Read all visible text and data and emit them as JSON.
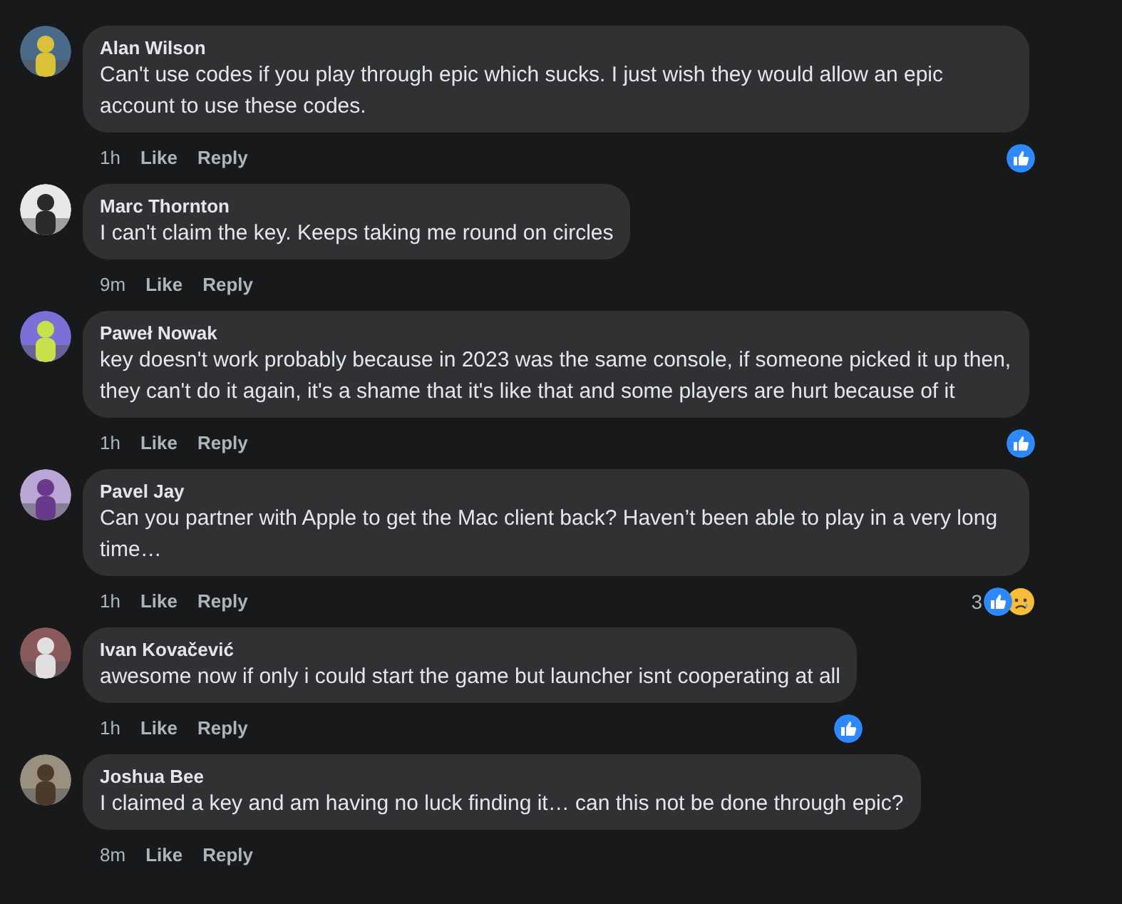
{
  "comments": [
    {
      "author": "Alan Wilson",
      "text": "Can't use codes if you play through epic which sucks. I just wish they would allow an epic account to use these codes.",
      "time": "1h",
      "like": "Like",
      "reply": "Reply",
      "reactions": [
        {
          "kind": "like"
        }
      ]
    },
    {
      "author": "Marc Thornton",
      "text": "I can't claim the key. Keeps taking me round on circles",
      "time": "9m",
      "like": "Like",
      "reply": "Reply"
    },
    {
      "author": "Paweł Nowak",
      "text": "key doesn't work probably because in 2023 was the same console, if someone picked it up then, they can't do it again, it's a shame that it's like that and some players are hurt because of it",
      "time": "1h",
      "like": "Like",
      "reply": "Reply",
      "reactions": [
        {
          "kind": "like"
        }
      ]
    },
    {
      "author": "Pavel Jay",
      "text": "Can you partner with Apple to get the Mac client back? Haven’t been able to play in a very long time…",
      "time": "1h",
      "like": "Like",
      "reply": "Reply",
      "reaction_count": "3",
      "reactions": [
        {
          "kind": "like"
        },
        {
          "kind": "sad"
        }
      ]
    },
    {
      "author": "Ivan Kovačević",
      "text": "awesome now if only i could start the game but launcher isnt cooperating at all",
      "time": "1h",
      "like": "Like",
      "reply": "Reply",
      "reactions": [
        {
          "kind": "like"
        }
      ]
    },
    {
      "author": "Joshua Bee",
      "text": "I claimed a key and am having no luck finding it… can this not be done through epic?",
      "time": "8m",
      "like": "Like",
      "reply": "Reply"
    }
  ]
}
